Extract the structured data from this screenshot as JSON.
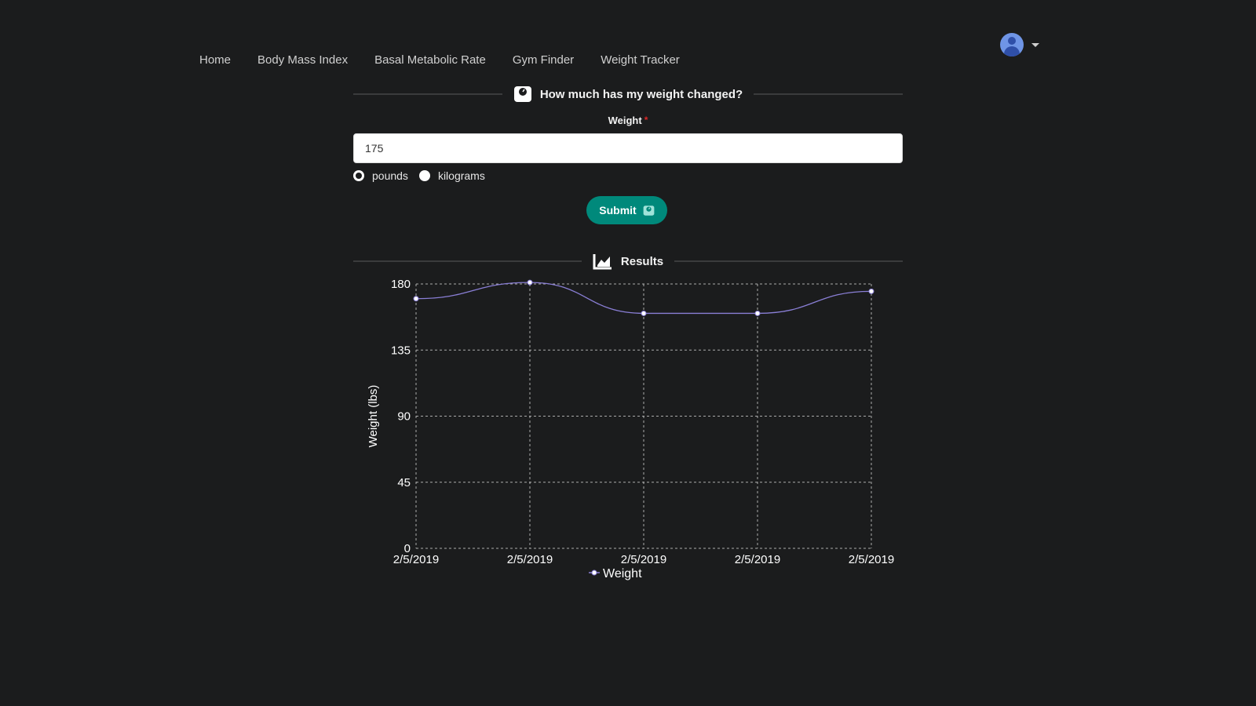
{
  "nav": {
    "items": [
      {
        "label": "Home"
      },
      {
        "label": "Body Mass Index"
      },
      {
        "label": "Basal Metabolic Rate"
      },
      {
        "label": "Gym Finder"
      },
      {
        "label": "Weight Tracker"
      }
    ]
  },
  "user_menu": {
    "avatar_icon": "user-avatar-icon",
    "caret_icon": "caret-down-icon"
  },
  "form": {
    "header": "How much has my weight changed?",
    "header_icon": "scale-icon",
    "weight_label": "Weight",
    "required_mark": "*",
    "weight_value": "175",
    "units": [
      {
        "label": "pounds",
        "checked": true
      },
      {
        "label": "kilograms",
        "checked": false
      }
    ],
    "submit_label": "Submit",
    "submit_icon": "scale-icon"
  },
  "results": {
    "header": "Results",
    "header_icon": "area-chart-icon"
  },
  "colors": {
    "background": "#1b1c1d",
    "accent": "#00897b",
    "line": "#8a7fd6",
    "grid": "#cfcfcf"
  },
  "chart_data": {
    "type": "line",
    "categories": [
      "2/5/2019",
      "2/5/2019",
      "2/5/2019",
      "2/5/2019",
      "2/5/2019"
    ],
    "series": [
      {
        "name": "Weight",
        "values": [
          170,
          181,
          160,
          160,
          175
        ]
      }
    ],
    "ylabel": "Weight (lbs)",
    "xlabel": "",
    "ylim": [
      0,
      180
    ],
    "yticks": [
      0,
      45,
      90,
      135,
      180
    ],
    "grid": true,
    "legend": "bottom"
  }
}
